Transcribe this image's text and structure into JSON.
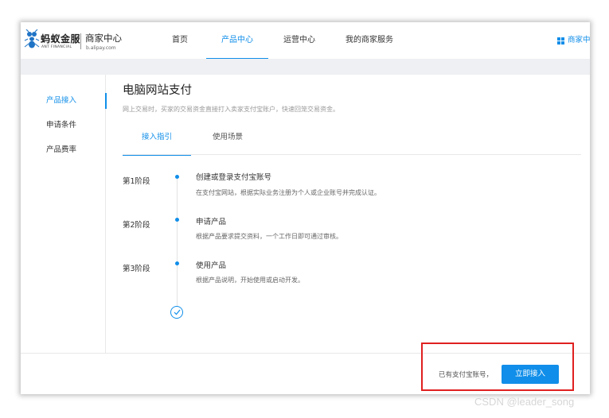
{
  "brand": {
    "name_cn": "蚂蚁金服",
    "name_en": "ANT FINANCIAL",
    "center_label": "商家中心",
    "domain": "b.alipay.com"
  },
  "topnav": {
    "items": [
      {
        "label": "首页"
      },
      {
        "label": "产品中心"
      },
      {
        "label": "运营中心"
      },
      {
        "label": "我的商家服务"
      }
    ],
    "active_index": 1,
    "right_label": "商家中"
  },
  "sidebar": {
    "items": [
      {
        "label": "产品接入"
      },
      {
        "label": "申请条件"
      },
      {
        "label": "产品费率"
      }
    ],
    "active_index": 0
  },
  "main": {
    "title": "电脑网站支付",
    "description": "网上交易时，买家的交易资金直接打入卖家支付宝账户，快速回笼交易资金。",
    "tabs": [
      {
        "label": "接入指引"
      },
      {
        "label": "使用场景"
      }
    ],
    "active_tab": 0,
    "steps": [
      {
        "stage": "第1阶段",
        "title": "创建或登录支付宝账号",
        "desc": "在支付宝网站，根据实际业务注册为个人或企业账号并完成认证。"
      },
      {
        "stage": "第2阶段",
        "title": "申请产品",
        "desc": "根据产品要求提交资料，一个工作日即可通过审核。"
      },
      {
        "stage": "第3阶段",
        "title": "使用产品",
        "desc": "根据产品说明，开始使用或启动开发。"
      }
    ]
  },
  "footer": {
    "prompt": "已有支付宝账号，",
    "button_label": "立即接入"
  },
  "watermark": "CSDN @leader_song",
  "colors": {
    "accent": "#108ee9",
    "highlight": "#e02020",
    "band": "#eef0f3"
  },
  "icons": [
    "ant-logo-icon",
    "grid-icon",
    "check-circle-icon"
  ]
}
